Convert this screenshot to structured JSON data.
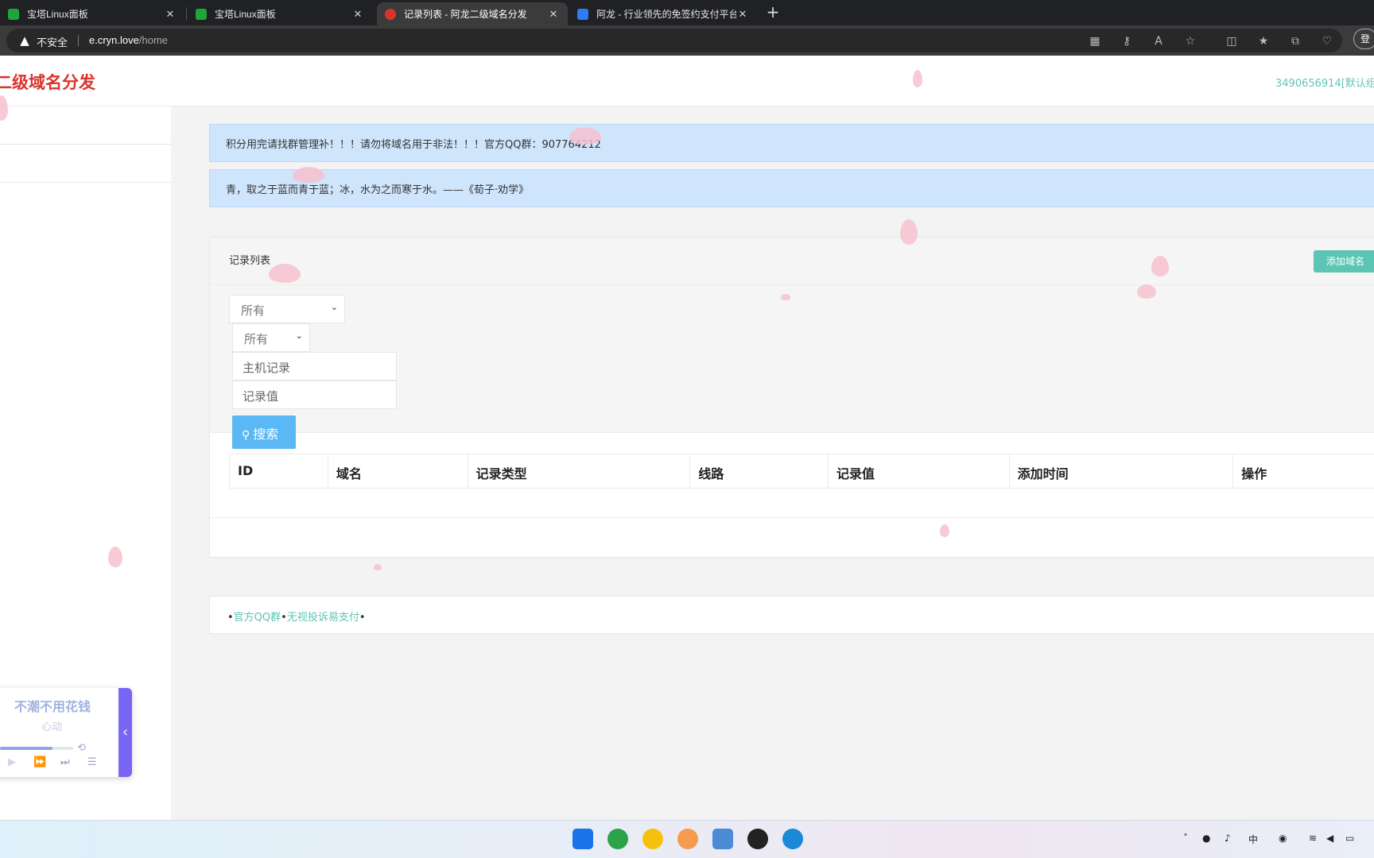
{
  "browser": {
    "tabs": [
      {
        "title": "宝塔Linux面板",
        "close": "✕",
        "favicon_color": "#20a53a"
      },
      {
        "title": "宝塔Linux面板",
        "close": "✕",
        "favicon_color": "#20a53a"
      },
      {
        "title": "记录列表 - 阿龙二级域名分发",
        "close": "✕",
        "favicon_color": "#d9342b"
      },
      {
        "title": "阿龙 - 行业领先的免签约支付平台",
        "close": "✕",
        "favicon_color": "#2f7bf5"
      }
    ],
    "new_tab": "+",
    "security_label": "不安全",
    "url_host": "e.cryn.love",
    "url_path": "/home",
    "login_label": "登"
  },
  "header": {
    "brand": "二级域名分发",
    "user": "3490656914[默认组]"
  },
  "notices": [
    "积分用完请找群管理补！！！请勿将域名用于非法！！！官方QQ群：907764212",
    "青，取之于蓝而青于蓝；冰，水为之而寒于水。——《荀子·劝学》"
  ],
  "records_panel": {
    "title": "记录列表",
    "add_button": "添加域名",
    "filters": {
      "domain_select": "所有",
      "type_select": "所有",
      "host_placeholder": "主机记录",
      "value_placeholder": "记录值",
      "search_button": "搜索"
    },
    "columns": [
      "ID",
      "域名",
      "记录类型",
      "线路",
      "记录值",
      "添加时间",
      "操作"
    ]
  },
  "footer": {
    "bullet": "•",
    "links": [
      "官方QQ群",
      "无视投诉易支付"
    ]
  },
  "music_player": {
    "song": "不潮不用花钱",
    "artist": "心动",
    "progress": 0.72
  },
  "taskbar": {
    "ime": "中"
  },
  "colors": {
    "brand_red": "#d9342b",
    "accent_teal": "#5cc5b4",
    "notice_blue": "#cfe5fb",
    "search_blue": "#5ab8f5",
    "player_purple": "#7865f4"
  }
}
